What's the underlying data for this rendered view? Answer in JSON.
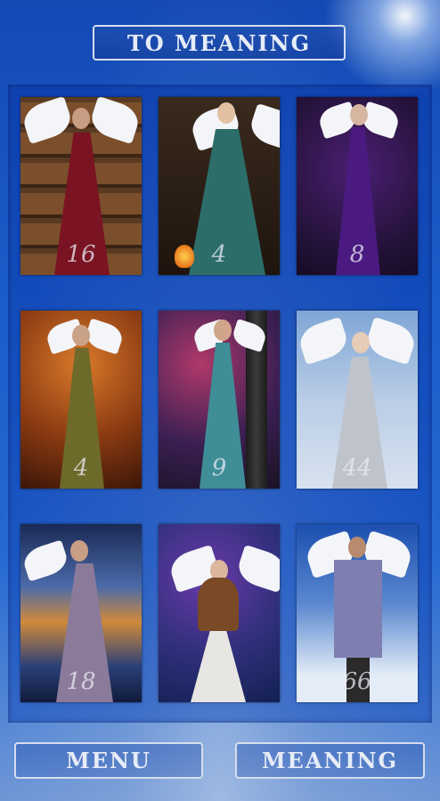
{
  "top_button": {
    "label": "TO MEANING"
  },
  "cards": [
    {
      "number": "16"
    },
    {
      "number": "4"
    },
    {
      "number": "8"
    },
    {
      "number": "4"
    },
    {
      "number": "9"
    },
    {
      "number": "44"
    },
    {
      "number": "18"
    },
    {
      "number": ""
    },
    {
      "number": "66"
    }
  ],
  "bottom": {
    "menu_label": "MENU",
    "meaning_label": "MEANING"
  }
}
